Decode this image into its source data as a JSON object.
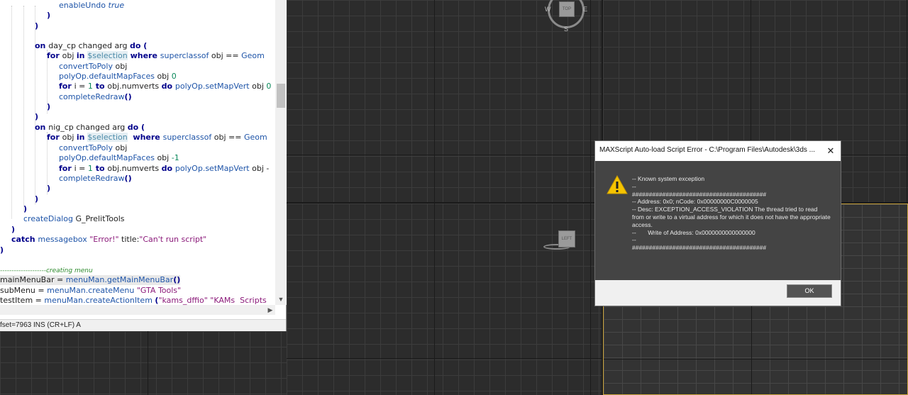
{
  "viewports": {
    "top": {
      "cube_label": "TOP",
      "compass": {
        "w": "W",
        "e": "E",
        "s": "S"
      }
    },
    "left": {
      "cube_label": "LEFT"
    }
  },
  "editor": {
    "lines": [
      [
        {
          "t": "enableUndo ",
          "c": "fn"
        },
        {
          "t": "true",
          "c": "it"
        }
      ],
      [
        {
          "t": ")",
          "c": "kw"
        }
      ],
      [
        {
          "t": ")",
          "c": "kw"
        }
      ],
      [],
      [
        {
          "t": "on ",
          "c": "kw"
        },
        {
          "t": "day_cp changed arg ",
          "c": ""
        },
        {
          "t": "do",
          "c": "kw"
        },
        {
          "t": " (",
          "c": "kw"
        }
      ],
      [
        {
          "t": "for ",
          "c": "kw"
        },
        {
          "t": "obj ",
          "c": ""
        },
        {
          "t": "in ",
          "c": "kw"
        },
        {
          "t": "$selection",
          "c": "sel"
        },
        {
          "t": " where ",
          "c": "kw"
        },
        {
          "t": "superclassof",
          "c": "fn"
        },
        {
          "t": " obj == ",
          "c": ""
        },
        {
          "t": "Geom",
          "c": "fn"
        }
      ],
      [
        {
          "t": "convertToPoly",
          "c": "fn"
        },
        {
          "t": " obj",
          "c": ""
        }
      ],
      [
        {
          "t": "polyOp.defaultMapFaces",
          "c": "fn"
        },
        {
          "t": " obj ",
          "c": ""
        },
        {
          "t": "0",
          "c": "num"
        }
      ],
      [
        {
          "t": "for ",
          "c": "kw"
        },
        {
          "t": "i = ",
          "c": ""
        },
        {
          "t": "1",
          "c": "num"
        },
        {
          "t": " to ",
          "c": "kw"
        },
        {
          "t": "obj.numverts ",
          "c": ""
        },
        {
          "t": "do ",
          "c": "kw"
        },
        {
          "t": "polyOp.setMapVert",
          "c": "fn"
        },
        {
          "t": " obj ",
          "c": ""
        },
        {
          "t": "0",
          "c": "num"
        }
      ],
      [
        {
          "t": "completeRedraw",
          "c": "fn"
        },
        {
          "t": "()",
          "c": "kw"
        }
      ],
      [
        {
          "t": ")",
          "c": "kw"
        }
      ],
      [
        {
          "t": ")",
          "c": "kw"
        }
      ],
      [
        {
          "t": "on ",
          "c": "kw"
        },
        {
          "t": "nig_cp changed arg ",
          "c": ""
        },
        {
          "t": "do",
          "c": "kw"
        },
        {
          "t": " (",
          "c": "kw"
        }
      ],
      [
        {
          "t": "for ",
          "c": "kw"
        },
        {
          "t": "obj ",
          "c": ""
        },
        {
          "t": "in ",
          "c": "kw"
        },
        {
          "t": "$selection",
          "c": "sel"
        },
        {
          "t": "  where ",
          "c": "kw"
        },
        {
          "t": "superclassof",
          "c": "fn"
        },
        {
          "t": " obj == ",
          "c": ""
        },
        {
          "t": "Geom",
          "c": "fn"
        }
      ],
      [
        {
          "t": "convertToPoly",
          "c": "fn"
        },
        {
          "t": " obj",
          "c": ""
        }
      ],
      [
        {
          "t": "polyOp.defaultMapFaces",
          "c": "fn"
        },
        {
          "t": " obj ",
          "c": ""
        },
        {
          "t": "-1",
          "c": "num"
        }
      ],
      [
        {
          "t": "for ",
          "c": "kw"
        },
        {
          "t": "i = ",
          "c": ""
        },
        {
          "t": "1",
          "c": "num"
        },
        {
          "t": " to ",
          "c": "kw"
        },
        {
          "t": "obj.numverts ",
          "c": ""
        },
        {
          "t": "do ",
          "c": "kw"
        },
        {
          "t": "polyOp.setMapVert",
          "c": "fn"
        },
        {
          "t": " obj -",
          "c": ""
        }
      ],
      [
        {
          "t": "completeRedraw",
          "c": "fn"
        },
        {
          "t": "()",
          "c": "kw"
        }
      ],
      [
        {
          "t": ")",
          "c": "kw"
        }
      ],
      [
        {
          "t": ")",
          "c": "kw"
        }
      ],
      [
        {
          "t": ")",
          "c": "kw"
        }
      ],
      [
        {
          "t": "createDialog",
          "c": "fn"
        },
        {
          "t": " G_PrelitTools",
          "c": ""
        }
      ],
      [
        {
          "t": ")",
          "c": "kw"
        }
      ],
      [
        {
          "t": "catch ",
          "c": "kw"
        },
        {
          "t": "messagebox ",
          "c": "fn"
        },
        {
          "t": "\"Error!\"",
          "c": "str"
        },
        {
          "t": " title:",
          "c": ""
        },
        {
          "t": "\"Can't run script\"",
          "c": "str"
        }
      ],
      [
        {
          "t": ")",
          "c": "kw"
        }
      ],
      [],
      [
        {
          "t": "--------------------creating menu",
          "c": "cm"
        }
      ],
      [
        {
          "t": "mainMenuBar = ",
          "c": ""
        },
        {
          "t": "menuMan.getMainMenuBar",
          "c": "fn"
        },
        {
          "t": "()",
          "c": "kw"
        }
      ],
      [
        {
          "t": "subMenu = ",
          "c": ""
        },
        {
          "t": "menuMan.createMenu ",
          "c": "fn"
        },
        {
          "t": "\"GTA Tools\"",
          "c": "str"
        }
      ],
      [
        {
          "t": "testItem = ",
          "c": ""
        },
        {
          "t": "menuMan.createActionItem ",
          "c": "fn"
        },
        {
          "t": "(",
          "c": "kw"
        },
        {
          "t": "\"kams_dffio\"",
          "c": "str"
        },
        {
          "t": " ",
          "c": ""
        },
        {
          "t": "\"KAMs  Scripts",
          "c": "str"
        }
      ]
    ],
    "status": "fset=7963 INS (CR+LF) A"
  },
  "dialog": {
    "title": "MAXScript Auto-load Script Error - C:\\Program Files\\Autodesk\\3ds ...",
    "close_glyph": "✕",
    "icon": "warning-icon",
    "message_lines": [
      "-- Known system exception",
      "--",
      "########################################",
      "-- Address: 0x0; nCode: 0x00000000C0000005",
      "-- Desc: EXCEPTION_ACCESS_VIOLATION The thread tried to read from or write to a virtual address for which it does not have the appropriate access.",
      "--       Write of Address: 0x0000000000000000",
      "--",
      "########################################"
    ],
    "ok_label": "OK"
  }
}
